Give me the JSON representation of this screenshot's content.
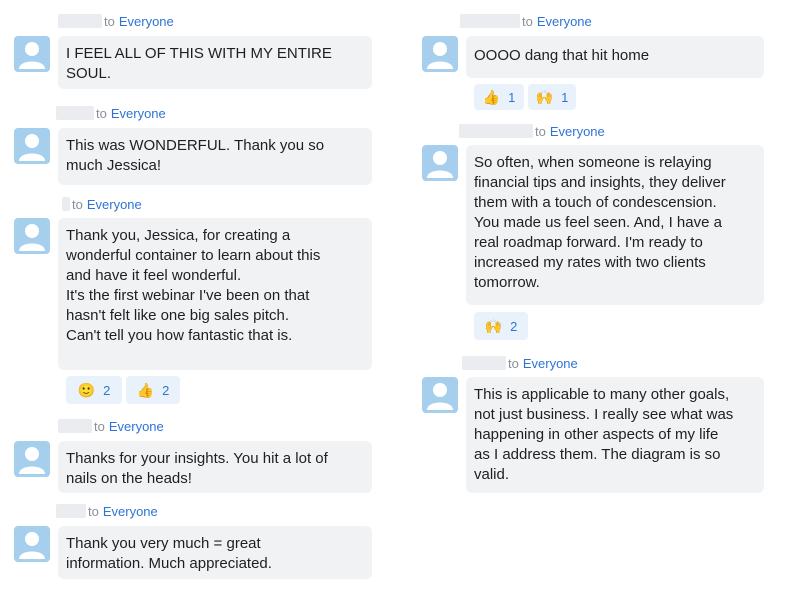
{
  "target_label": "to",
  "audience": "Everyone",
  "left": [
    {
      "lines": [
        "I FEEL ALL OF THIS WITH MY ENTIRE",
        "SOUL."
      ],
      "reactions": []
    },
    {
      "lines": [
        "This was WONDERFUL. Thank you so",
        "much Jessica!"
      ],
      "reactions": []
    },
    {
      "lines": [
        "Thank you, Jessica, for creating a",
        "wonderful container to learn about this",
        "and have it feel wonderful.",
        "It's the first webinar I've been on that",
        "hasn't felt like one big sales pitch.",
        "Can't tell you how fantastic that is."
      ],
      "reactions": [
        {
          "emoji": "🙂",
          "count": "2",
          "icon": "smile-emoji-icon"
        },
        {
          "emoji": "👍",
          "count": "2",
          "icon": "thumbs-up-icon"
        }
      ]
    },
    {
      "lines": [
        "Thanks for your insights. You hit a lot of",
        "nails on the heads!"
      ],
      "reactions": []
    },
    {
      "lines": [
        "Thank you very much = great",
        "information. Much appreciated."
      ],
      "reactions": []
    }
  ],
  "right": [
    {
      "lines": [
        "OOOO dang that hit home"
      ],
      "reactions": [
        {
          "emoji": "👍",
          "count": "1",
          "icon": "thumbs-up-icon"
        },
        {
          "emoji": "🙌",
          "count": "1",
          "icon": "raised-hands-icon"
        }
      ]
    },
    {
      "lines": [
        "So often, when someone is relaying",
        "financial tips and insights, they deliver",
        "them with a touch of condescension.",
        "You made us feel seen. And, I have a",
        "real roadmap forward. I'm ready to",
        "increased my rates with two clients",
        "tomorrow."
      ],
      "reactions": [
        {
          "emoji": "🙌",
          "count": "2",
          "icon": "raised-hands-icon"
        }
      ]
    },
    {
      "lines": [
        "This is applicable to many other goals,",
        "not just business. I really see what was",
        "happening in other aspects of my life",
        "as I address them. The diagram is so",
        "valid."
      ],
      "reactions": []
    }
  ]
}
